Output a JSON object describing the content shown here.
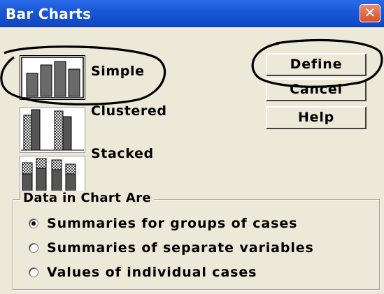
{
  "window": {
    "title": "Bar Charts",
    "close_glyph": "✕"
  },
  "chart_types": [
    {
      "label": "Simple",
      "icon": "simple-bar-chart-icon",
      "selected": true
    },
    {
      "label": "Clustered",
      "icon": "clustered-bar-chart-icon",
      "selected": false
    },
    {
      "label": "Stacked",
      "icon": "stacked-bar-chart-icon",
      "selected": false
    }
  ],
  "buttons": {
    "define": "Define",
    "cancel": "Cancel",
    "help": "Help"
  },
  "data_group": {
    "title": "Data in Chart Are",
    "options": [
      {
        "label": "Summaries for groups of cases",
        "selected": true
      },
      {
        "label": "Summaries of separate variables",
        "selected": false
      },
      {
        "label": "Values of individual cases",
        "selected": false
      }
    ]
  },
  "colors": {
    "title_bar": "#1a56d4",
    "dialog_bg": "#ece9d8",
    "annotation_ink": "#000000"
  }
}
